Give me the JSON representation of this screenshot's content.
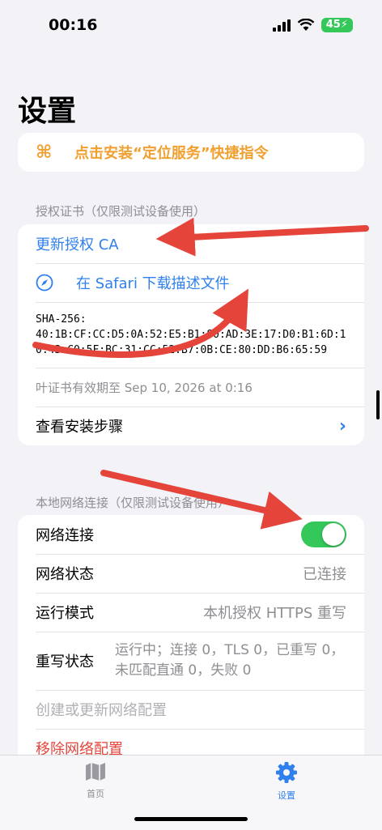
{
  "status": {
    "time": "00:16",
    "battery": "45"
  },
  "page_title": "设置",
  "shortcut": {
    "icon": "command-icon",
    "label": "点击安装“定位服务”快捷指令"
  },
  "cert_section": {
    "header": "授权证书（仅限测试设备使用）",
    "update_ca": "更新授权 CA",
    "download_profile": "在 Safari 下载描述文件",
    "sha": "SHA-256:\n40:1B:CF:CC:D5:0A:52:E5:B1:80:AD:3E:17:D0:B1:6D:10:43:C0:5F:BC:31:CC:52:B7:0B:CE:80:DD:B6:65:59",
    "expiry": "叶证书有效期至 Sep 10, 2026 at 0:16",
    "view_steps": "查看安装步骤"
  },
  "net_section": {
    "header": "本地网络连接（仅限测试设备使用）",
    "connection_label": "网络连接",
    "connection_on": true,
    "status_label": "网络状态",
    "status_value": "已连接",
    "mode_label": "运行模式",
    "mode_value": "本机授权 HTTPS 重写",
    "rewrite_label": "重写状态",
    "rewrite_value": "运行中；连接 0，TLS 0，已重写 0，未匹配直通 0，失败 0",
    "create_config": "创建或更新网络配置",
    "remove_config": "移除网络配置"
  },
  "tabbar": {
    "home_label": "首页",
    "settings_label": "设置"
  },
  "colors": {
    "accent_blue": "#2f80ed",
    "orange": "#f0a030",
    "toggle_green": "#34c759",
    "annotation_red": "#e5443a"
  }
}
